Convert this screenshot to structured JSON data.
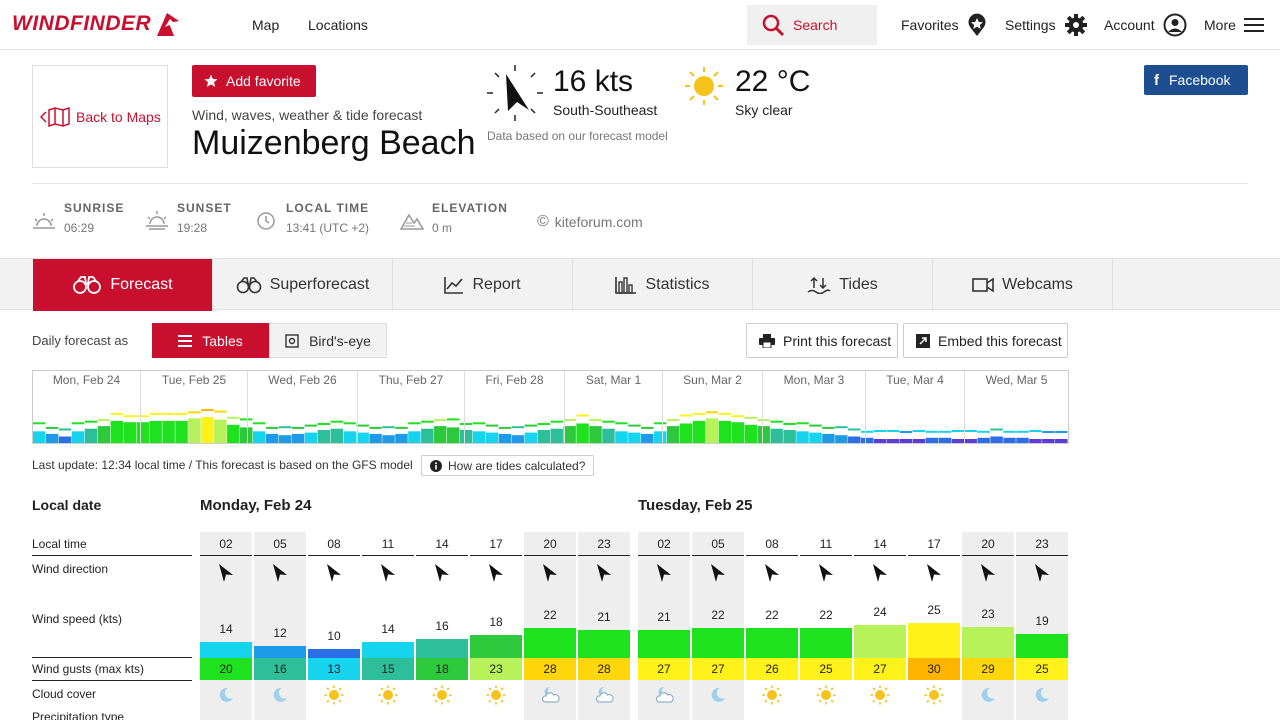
{
  "nav": {
    "logo": "WINDFINDER",
    "links": [
      "Map",
      "Locations"
    ],
    "search_label": "Search",
    "favorites_label": "Favorites",
    "settings_label": "Settings",
    "account_label": "Account",
    "more_label": "More"
  },
  "header": {
    "back_label": "Back to Maps",
    "favorite_label": "Add favorite",
    "subtitle": "Wind, waves, weather & tide forecast",
    "title": "Muizenberg Beach",
    "wind_value": "16 kts",
    "wind_direction": "South-Southeast",
    "model_note": "Data based on our forecast model",
    "temp_value": "22 °C",
    "sky": "Sky clear",
    "facebook_label": "Facebook"
  },
  "info": {
    "sunrise_label": "SUNRISE",
    "sunrise": "06:29",
    "sunset_label": "SUNSET",
    "sunset": "19:28",
    "localtime_label": "LOCAL TIME",
    "localtime": "13:41 (UTC +2)",
    "elevation_label": "ELEVATION",
    "elevation": "0 m",
    "source": "kiteforum.com"
  },
  "tabs": [
    "Forecast",
    "Superforecast",
    "Report",
    "Statistics",
    "Tides",
    "Webcams"
  ],
  "controls": {
    "daily_label": "Daily forecast as",
    "tables_label": "Tables",
    "birdseye_label": "Bird's-eye",
    "print_label": "Print this forecast",
    "embed_label": "Embed this forecast"
  },
  "overview": {
    "days": [
      "Mon, Feb 24",
      "Tue, Feb 25",
      "Wed, Feb 26",
      "Thu, Feb 27",
      "Fri, Feb 28",
      "Sat, Mar 1",
      "Sun, Mar 2",
      "Mon, Mar 3",
      "Tue, Mar 4",
      "Wed, Mar 5"
    ]
  },
  "update_text": "Last update: 12:34 local time / This forecast is based on the GFS model",
  "tides_question": "How are tides calculated?",
  "table": {
    "labels": {
      "local_date": "Local date",
      "local_time": "Local time",
      "wind_direction": "Wind direction",
      "wind_speed": "Wind speed (kts)",
      "wind_gusts": "Wind gusts (max kts)",
      "cloud_cover": "Cloud cover",
      "precip_type": "Precipitation type"
    },
    "days": [
      {
        "date": "Monday, Feb 24",
        "times": [
          "02",
          "05",
          "08",
          "11",
          "14",
          "17",
          "20",
          "23"
        ],
        "speeds": [
          14,
          12,
          10,
          14,
          16,
          18,
          22,
          21
        ],
        "gusts": [
          20,
          16,
          13,
          15,
          18,
          23,
          28,
          28
        ],
        "cloud": [
          "moon",
          "moon",
          "sun",
          "sun",
          "sun",
          "sun",
          "cloud-moon",
          "cloud-moon"
        ]
      },
      {
        "date": "Tuesday, Feb 25",
        "times": [
          "02",
          "05",
          "08",
          "11",
          "14",
          "17",
          "20",
          "23"
        ],
        "speeds": [
          21,
          22,
          22,
          22,
          24,
          25,
          23,
          19
        ],
        "gusts": [
          27,
          27,
          26,
          25,
          27,
          30,
          29,
          25
        ],
        "cloud": [
          "cloud-moon",
          "moon",
          "sun",
          "sun",
          "sun",
          "sun",
          "moon",
          "moon"
        ]
      }
    ]
  },
  "colors": {
    "brand": "#c8102e",
    "facebook": "#1d4e8f"
  }
}
